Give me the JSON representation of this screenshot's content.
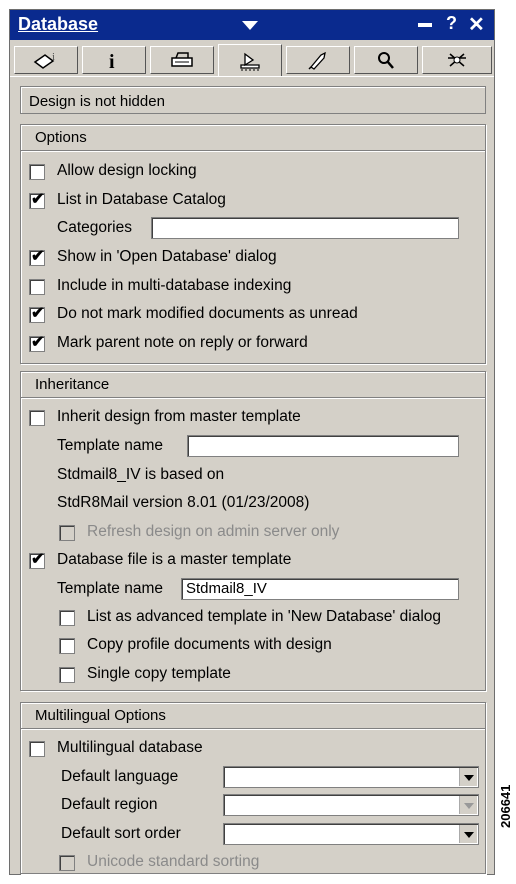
{
  "window": {
    "title": "Database"
  },
  "tabs": [
    {
      "icon": "info-bubble-icon"
    },
    {
      "icon": "info-icon"
    },
    {
      "icon": "printer-icon"
    },
    {
      "icon": "design-icon"
    },
    {
      "icon": "launch-icon"
    },
    {
      "icon": "search-icon"
    },
    {
      "icon": "advanced-icon"
    }
  ],
  "status": "Design is not hidden",
  "options": {
    "title": "Options",
    "allow_design_locking": {
      "label": "Allow design locking",
      "checked": false
    },
    "list_in_catalog": {
      "label": "List in Database Catalog",
      "checked": true
    },
    "categories": {
      "label": "Categories",
      "value": ""
    },
    "show_open_dialog": {
      "label": "Show in 'Open Database' dialog",
      "checked": true
    },
    "multi_db_indexing": {
      "label": "Include in multi-database indexing",
      "checked": false
    },
    "not_mark_unread": {
      "label": "Do not mark modified documents as unread",
      "checked": true
    },
    "mark_parent_note": {
      "label": "Mark parent note on reply or forward",
      "checked": true
    }
  },
  "inheritance": {
    "title": "Inheritance",
    "inherit_design": {
      "label": "Inherit design from master template",
      "checked": false
    },
    "template_name_1": {
      "label": "Template name",
      "value": ""
    },
    "based_on_line1": "Stdmail8_IV is based on",
    "based_on_line2": "StdR8Mail version 8.01 (01/23/2008)",
    "refresh_admin": {
      "label": "Refresh design on admin server only",
      "checked": false
    },
    "is_master": {
      "label": "Database file is a master template",
      "checked": true
    },
    "template_name_2": {
      "label": "Template name",
      "value": "Stdmail8_IV"
    },
    "list_advanced": {
      "label": "List as advanced template in 'New Database' dialog",
      "checked": false
    },
    "copy_profile": {
      "label": "Copy profile documents with design",
      "checked": false
    },
    "single_copy": {
      "label": "Single copy template",
      "checked": false
    }
  },
  "multilingual": {
    "title": "Multilingual Options",
    "multilingual_db": {
      "label": "Multilingual database",
      "checked": false
    },
    "default_language": {
      "label": "Default language",
      "value": ""
    },
    "default_region": {
      "label": "Default region",
      "value": ""
    },
    "default_sort": {
      "label": "Default sort order",
      "value": ""
    },
    "unicode_sorting": {
      "label": "Unicode standard sorting",
      "checked": false
    }
  },
  "figure_id": "206641"
}
